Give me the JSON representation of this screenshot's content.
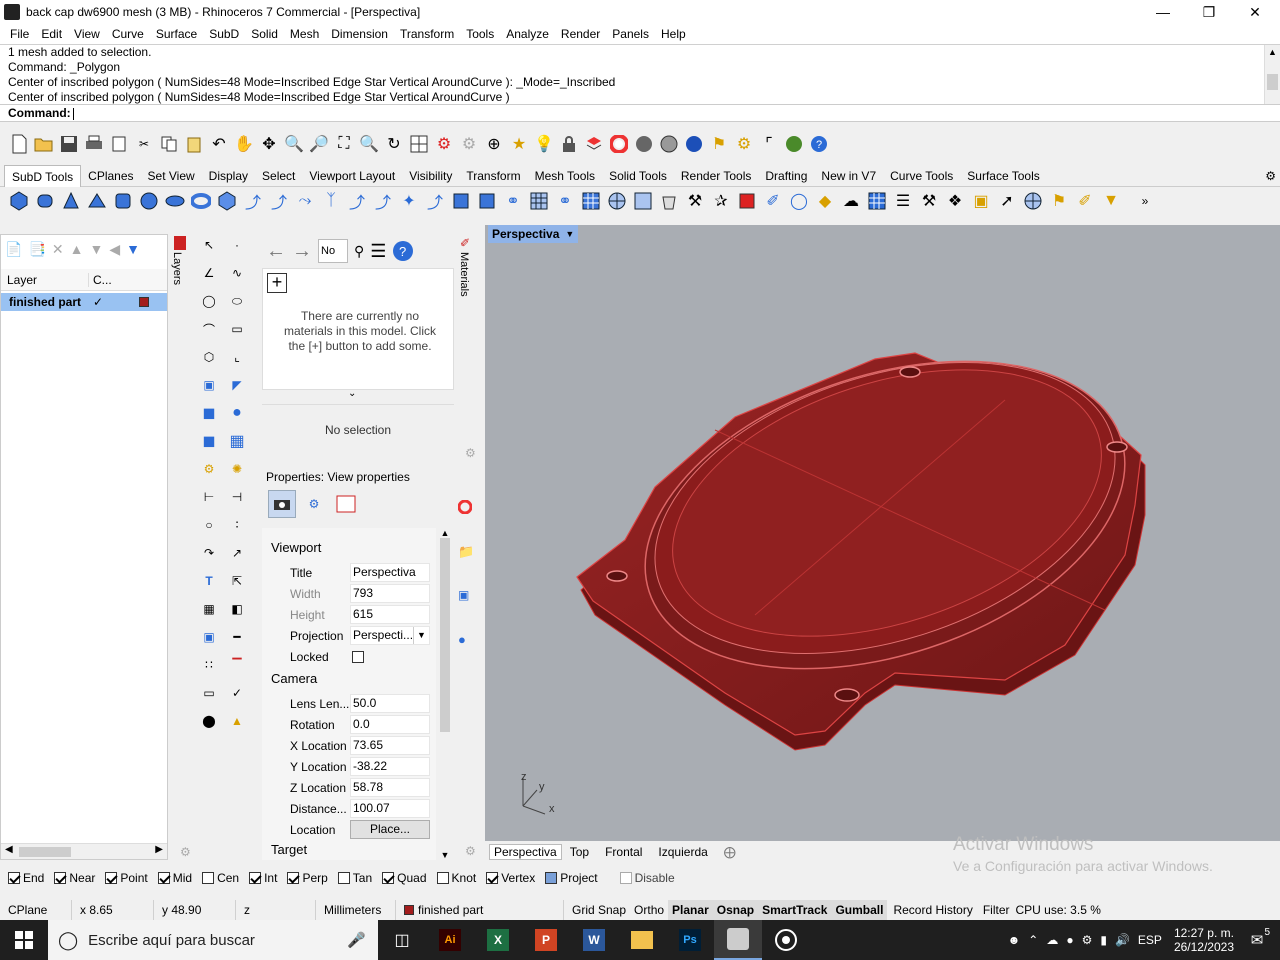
{
  "window": {
    "title": "back cap dw6900 mesh (3 MB) - Rhinoceros 7 Commercial - [Perspectiva]"
  },
  "menu": [
    "File",
    "Edit",
    "View",
    "Curve",
    "Surface",
    "SubD",
    "Solid",
    "Mesh",
    "Dimension",
    "Transform",
    "Tools",
    "Analyze",
    "Render",
    "Panels",
    "Help"
  ],
  "command_history": [
    "1 mesh added to selection.",
    "Command: _Polygon",
    "Center of inscribed polygon ( NumSides=48  Mode=Inscribed  Edge  Star  Vertical  AroundCurve ): _Mode=_Inscribed",
    "Center of inscribed polygon ( NumSides=48  Mode=Inscribed  Edge  Star  Vertical  AroundCurve )"
  ],
  "command_prompt": "Command:",
  "toolbar_tabs": [
    "SubD Tools",
    "CPlanes",
    "Set View",
    "Display",
    "Select",
    "Viewport Layout",
    "Visibility",
    "Transform",
    "Mesh Tools",
    "Solid Tools",
    "Render Tools",
    "Drafting",
    "New in V7",
    "Curve Tools",
    "Surface Tools"
  ],
  "layers": {
    "tab_label": "Layers",
    "col_layer": "Layer",
    "col_current": "C...",
    "row_name": "finished part",
    "row_color": "#a31d1d"
  },
  "materials": {
    "tab_label": "Materials",
    "search": "No ...",
    "empty_text": "There are currently no materials in this model. Click the [+] button to add some.",
    "no_selection": "No selection"
  },
  "properties": {
    "header": "Properties: View properties",
    "section_viewport": "Viewport",
    "section_camera": "Camera",
    "section_target": "Target",
    "rows": [
      {
        "label": "Title",
        "value": "Perspectiva"
      },
      {
        "label": "Width",
        "value": "793"
      },
      {
        "label": "Height",
        "value": "615"
      },
      {
        "label": "Projection",
        "value": "Perspecti..."
      },
      {
        "label": "Locked",
        "value": ""
      },
      {
        "label": "Lens Len...",
        "value": "50.0"
      },
      {
        "label": "Rotation",
        "value": "0.0"
      },
      {
        "label": "X Location",
        "value": "73.65"
      },
      {
        "label": "Y Location",
        "value": "-38.22"
      },
      {
        "label": "Z Location",
        "value": "58.78"
      },
      {
        "label": "Distance...",
        "value": "100.07"
      },
      {
        "label": "Location",
        "value": "Place..."
      }
    ]
  },
  "viewport": {
    "label": "Perspectiva",
    "axis_x": "x",
    "axis_y": "y",
    "axis_z": "z",
    "tabs": [
      "Perspectiva",
      "Top",
      "Frontal",
      "Izquierda"
    ],
    "watermark_title": "Activar Windows",
    "watermark_sub": "Ve a Configuración para activar Windows."
  },
  "osnaps": [
    {
      "label": "End",
      "on": true
    },
    {
      "label": "Near",
      "on": true
    },
    {
      "label": "Point",
      "on": true
    },
    {
      "label": "Mid",
      "on": true
    },
    {
      "label": "Cen",
      "on": false
    },
    {
      "label": "Int",
      "on": true
    },
    {
      "label": "Perp",
      "on": true
    },
    {
      "label": "Tan",
      "on": false
    },
    {
      "label": "Quad",
      "on": true
    },
    {
      "label": "Knot",
      "on": false
    },
    {
      "label": "Vertex",
      "on": true
    },
    {
      "label": "Project",
      "on": true
    },
    {
      "label": "Disable",
      "on": false
    }
  ],
  "statusbar": {
    "cplane": "CPlane",
    "x": "x 8.65",
    "y": "y 48.90",
    "z": "z",
    "units": "Millimeters",
    "layer": "finished part",
    "grid_snap": "Grid Snap",
    "ortho": "Ortho",
    "planar": "Planar",
    "osnap": "Osnap",
    "smarttrack": "SmartTrack",
    "gumball": "Gumball",
    "record_history": "Record History",
    "filter": "Filter",
    "cpu": "CPU use: 3.5 %"
  },
  "taskbar": {
    "search_placeholder": "Escribe aquí para buscar",
    "lang": "ESP",
    "time": "12:27 p. m.",
    "date": "26/12/2023",
    "notifications": "5"
  },
  "colors": {
    "accent": "#99c2f2",
    "model_red": "#8b1c1c",
    "viewport_bg": "#a9adb3"
  }
}
